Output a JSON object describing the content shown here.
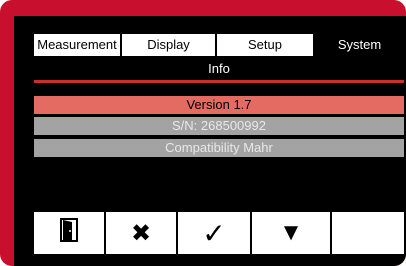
{
  "tabs": [
    {
      "label": "Measurement",
      "active": false
    },
    {
      "label": "Display",
      "active": false
    },
    {
      "label": "Setup",
      "active": false
    },
    {
      "label": "System",
      "active": true
    }
  ],
  "subheader": "Info",
  "info": {
    "version": "Version 1.7",
    "serial": "S/N: 268500992",
    "compatibility": "Compatibility Mahr"
  },
  "buttons": [
    {
      "icon": "exit-door-icon",
      "glyph": ""
    },
    {
      "icon": "close-icon",
      "glyph": "✖"
    },
    {
      "icon": "check-icon",
      "glyph": "✓"
    },
    {
      "icon": "triangle-down-icon",
      "glyph": "▼"
    },
    {
      "icon": "",
      "glyph": ""
    }
  ],
  "colors": {
    "frame": "#c8102e",
    "accent_line": "#c9302c",
    "version_row": "#e46b62",
    "info_row": "#a3a3a3"
  }
}
